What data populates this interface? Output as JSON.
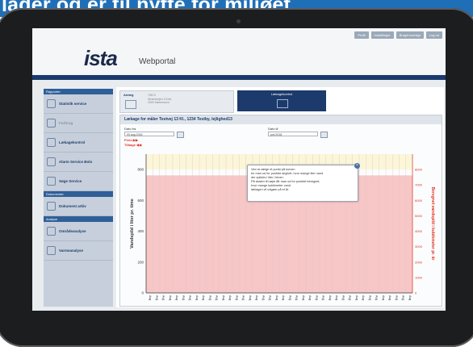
{
  "banner": {
    "text": "lader og er til nytte for miljøet."
  },
  "app": {
    "logo": "ista",
    "portal_name": "Webportal"
  },
  "topnav": [
    "Profil",
    "Indstillinger",
    "Brugeroversigt",
    "Log ud"
  ],
  "sidebar": {
    "sections": [
      {
        "header": "Rapporter",
        "items": [
          {
            "label": "Statistik service",
            "dim": false
          },
          {
            "label": "Forbrug",
            "dim": true
          },
          {
            "label": "Lækagekontrol",
            "dim": false
          },
          {
            "label": "Alarm Service Bolo",
            "dim": false
          },
          {
            "label": "Søge Service",
            "dim": false
          }
        ]
      },
      {
        "header": "Dokumenter",
        "items": [
          {
            "label": "Dokument arkiv",
            "dim": false
          }
        ]
      },
      {
        "header": "Analyse",
        "items": [
          {
            "label": "Områdeanalyse",
            "dim": false
          },
          {
            "label": "Varmeanalyse",
            "dim": false
          }
        ]
      }
    ]
  },
  "tabs": {
    "tab1": {
      "title": "Anlæg",
      "text": "75674\nStrandvejen 13 kld.\n2000 København"
    },
    "tab2": {
      "title": "Lækagekontrol"
    }
  },
  "panel": {
    "title": "Lækage for måler Testvej 13 Kl., 1234 Testby, lejlighed13",
    "date_from_label": "Dato fra",
    "date_from_value": "09 aug 2016",
    "date_to_label": "Dato til",
    "date_to_value": "juni 2016",
    "link_frem": "Frem ▶▶",
    "link_tilbage": "Tilbage ◀◀"
  },
  "tooltip": {
    "lines": [
      "Ved at vælge et punkt på kurven",
      "for man ud for punktet angivet, hvor mange liter vand",
      "der spildes i liter i timen.",
      "På skalen til højre får man ud for punktet beregnet,",
      "hvor mange kubikmeter vand",
      "lækagen vil udgøre på et år."
    ]
  },
  "highlight_value": "762",
  "colors": {
    "accent": "#1d3a6c",
    "pink_fill": "#f7c6c6",
    "yellow_fill": "#fbf6d8",
    "red_axis": "#e0301e"
  },
  "chart_data": {
    "type": "area",
    "ylabel_left": "Vandspild i liter pr. time",
    "ylabel_right": "Beregnet vandspild i kubikmeter pr. år",
    "yticks_left": [
      "0",
      "200",
      "400",
      "600",
      "800"
    ],
    "yticks_right": [
      "0",
      "1000",
      "2000",
      "3000",
      "4000",
      "5000",
      "6000",
      "7000",
      "8000"
    ],
    "x_tick_label": "Aug",
    "x_tick_count": 40,
    "highlight_value": 762,
    "ylim_left": [
      0,
      900
    ],
    "ylim_right": [
      0,
      9000
    ]
  }
}
